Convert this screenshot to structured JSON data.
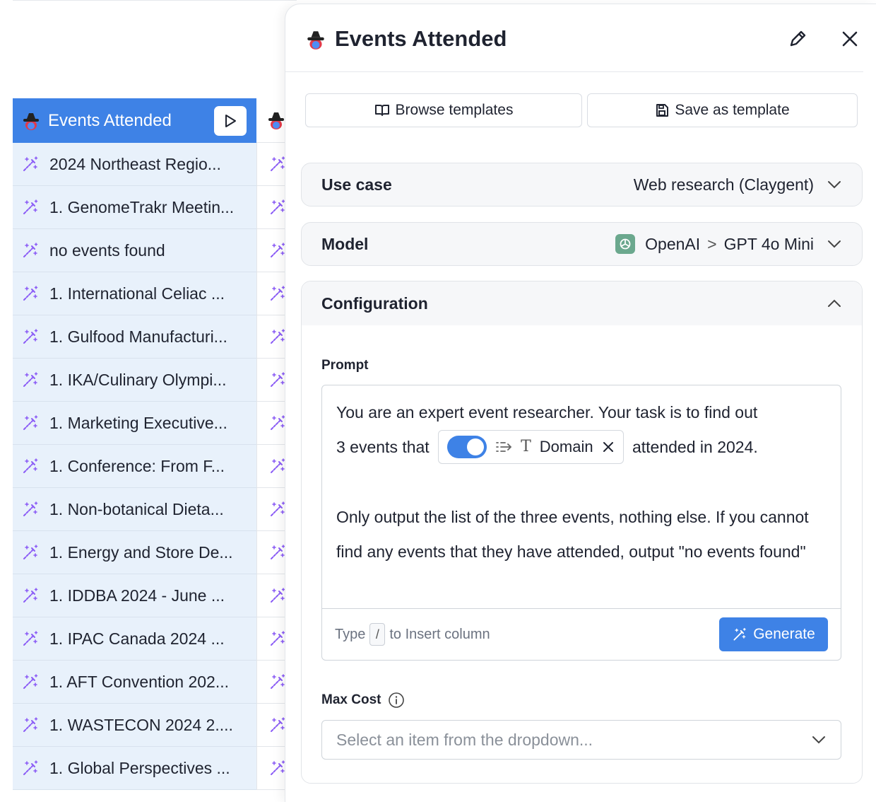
{
  "table": {
    "column_header": "Events Attended",
    "rows": [
      "2024 Northeast Regio...",
      "1. GenomeTrakr Meetin...",
      "no events found",
      "1. International Celiac ...",
      "1. Gulfood Manufacturi...",
      "1. IKA/Culinary Olympi...",
      "1. Marketing Executive...",
      "1. Conference: From F...",
      "1. Non-botanical Dieta...",
      "1. Energy and Store De...",
      "1. IDDBA 2024 - June ...",
      "1. IPAC Canada 2024 ...",
      "1. AFT Convention 202...",
      "1. WASTECON 2024 2....",
      "1. Global Perspectives ..."
    ]
  },
  "panel": {
    "title": "Events Attended",
    "browse_label": "Browse templates",
    "save_label": "Save as template",
    "use_case": {
      "label": "Use case",
      "value": "Web research (Claygent)"
    },
    "model": {
      "label": "Model",
      "provider": "OpenAI",
      "separator": ">",
      "name": "GPT 4o Mini"
    },
    "configuration": {
      "label": "Configuration",
      "prompt_label": "Prompt",
      "prompt_line1": "You are an expert event researcher. Your task is to find out",
      "prompt_before_chip": "3 events that",
      "chip_label": "Domain",
      "prompt_after_chip": "attended in 2024.",
      "prompt_para2": "Only output the list of the three events, nothing else. If you cannot find any events that they have attended, output \"no events found\"",
      "hint_type": "Type",
      "hint_slash": "/",
      "hint_rest": "to Insert column",
      "generate_label": "Generate",
      "max_cost_label": "Max Cost",
      "max_cost_placeholder": "Select an item from the dropdown..."
    }
  },
  "colors": {
    "accent": "#3e82e6",
    "row_bg": "#e8f1fb",
    "wand": "#8b5cf6"
  }
}
